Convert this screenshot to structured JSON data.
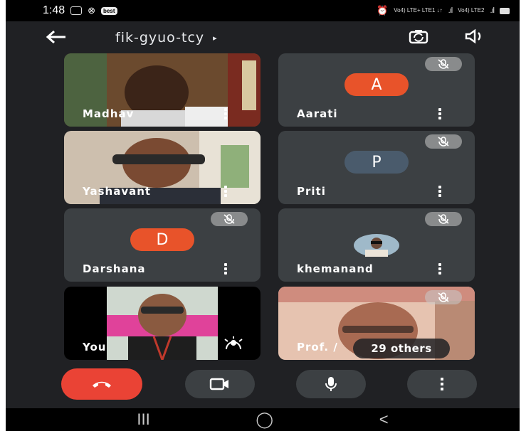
{
  "status": {
    "time": "1:48",
    "badge": "best",
    "net1": "Vo4) LTE+ LTE1 ↓↑",
    "net2": "Vo4) LTE2"
  },
  "meeting": {
    "code": "fik-gyuo-tcy",
    "caret": "▸"
  },
  "participants": [
    {
      "name": "Madhav",
      "muted": false,
      "has_video": true
    },
    {
      "name": "Aarati",
      "initial": "A",
      "muted": true,
      "avatar_color": "#e8532a"
    },
    {
      "name": "Yashavant",
      "muted": false,
      "has_video": true
    },
    {
      "name": "Priti",
      "initial": "P",
      "muted": true,
      "avatar_color": "#4a5b6c"
    },
    {
      "name": "Darshana",
      "initial": "D",
      "muted": true,
      "avatar_color": "#e8532a"
    },
    {
      "name": "khemanand",
      "muted": true,
      "has_photo": true
    },
    {
      "name": "You",
      "muted": false,
      "has_video": true
    },
    {
      "name": "Prof. /",
      "muted": true,
      "has_video": true
    }
  ],
  "others": "29 others",
  "controls": [
    "end-call",
    "camera",
    "microphone",
    "more-options"
  ],
  "colors": {
    "background": "#202124",
    "tile": "#3c4043",
    "end_call": "#ea4335",
    "avatar_orange": "#e8532a",
    "avatar_slate": "#4a5b6c"
  },
  "navbar": {
    "recent": "III",
    "home": "◯",
    "back": "<"
  }
}
